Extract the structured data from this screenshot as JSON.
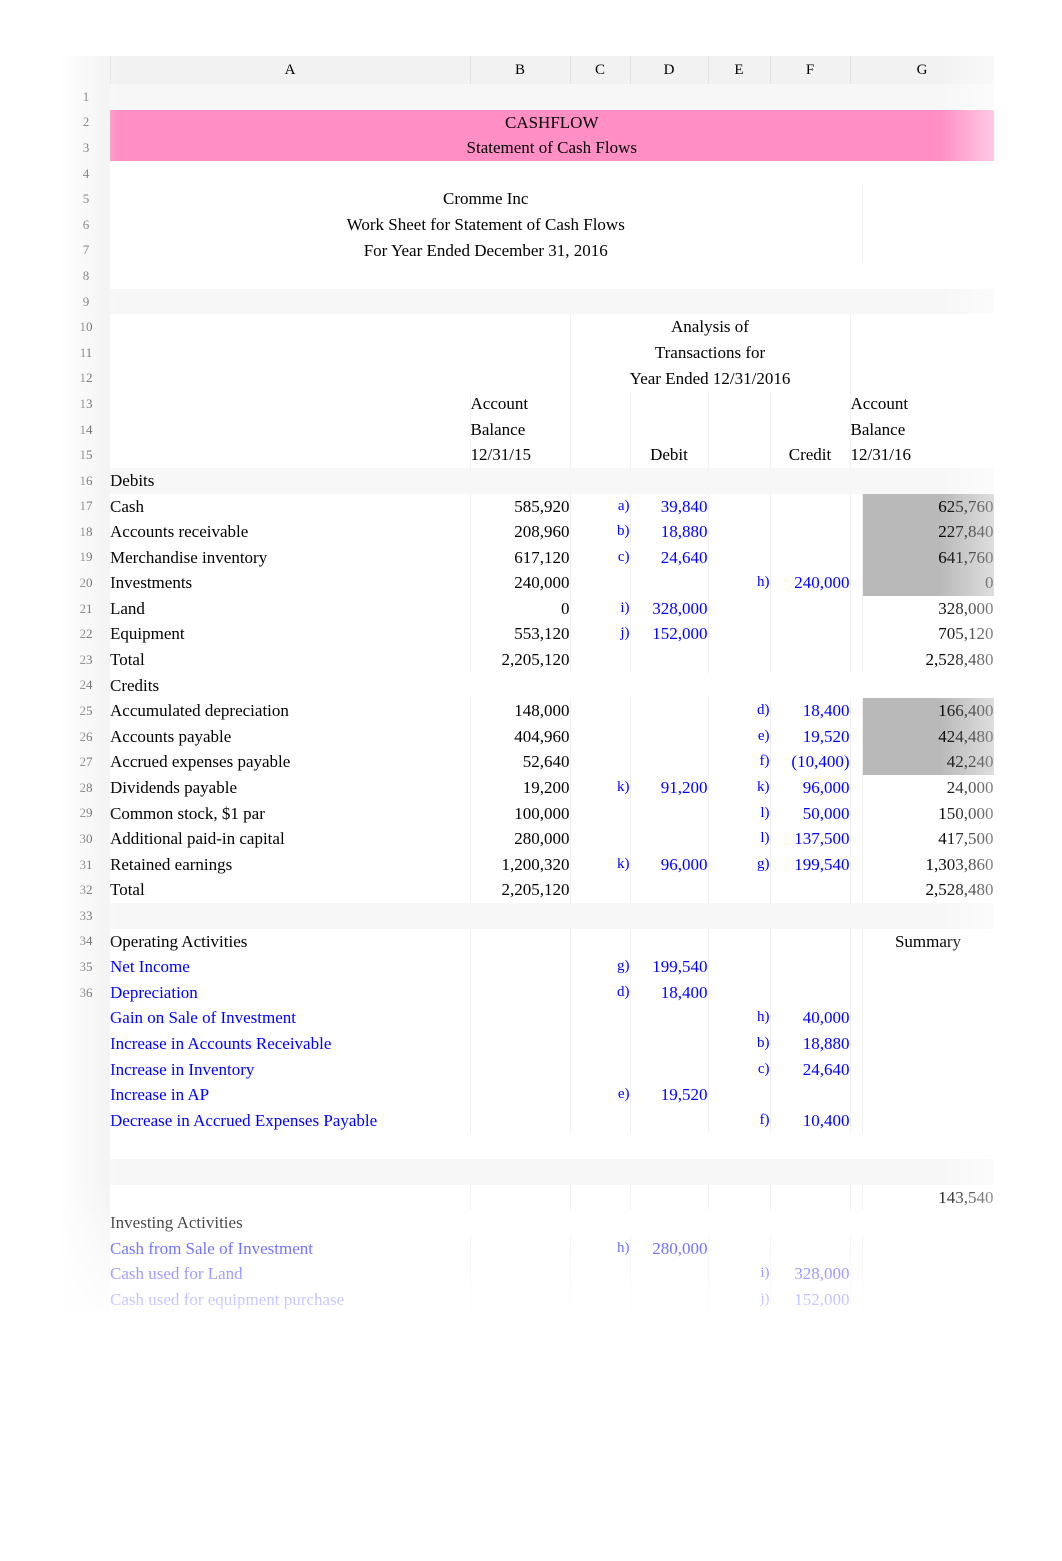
{
  "sheet": {
    "column_headers": [
      "A",
      "B",
      "C",
      "D",
      "E",
      "F",
      "G"
    ],
    "row_numbers": [
      "1",
      "2",
      "3",
      "4",
      "5",
      "6",
      "7",
      "8",
      "9",
      "10",
      "11",
      "12",
      "13",
      "14",
      "15",
      "16",
      "17",
      "18",
      "19",
      "20",
      "21",
      "22",
      "23",
      "24",
      "25",
      "26",
      "27",
      "28",
      "29",
      "30",
      "31",
      "32",
      "33",
      "34",
      "35",
      "36"
    ]
  },
  "colors": {
    "banner_pink": "#ff8fc4",
    "selection_gray": "#b9b9b9",
    "entry_blue": "#0000ff",
    "text_black": "#000000"
  },
  "banner": {
    "line1": "CASHFLOW",
    "line2": "Statement of Cash Flows"
  },
  "title_block": {
    "company": "Cromme Inc",
    "subtitle": "Work Sheet for Statement of Cash Flows",
    "period": "For Year Ended December 31, 2016"
  },
  "analysis_header": {
    "line1": "Analysis of",
    "line2": "Transactions for",
    "line3": "Year Ended 12/31/2016"
  },
  "column_labels": {
    "bal_open_1": "Account",
    "bal_open_2": "Balance",
    "bal_open_3": "12/31/15",
    "debit": "Debit",
    "credit": "Credit",
    "bal_close_1": "Account",
    "bal_close_2": "Balance",
    "bal_close_3": "12/31/16",
    "summary": "Summary"
  },
  "sections": {
    "debits_label": "Debits",
    "credits_label": "Credits",
    "operating_label": "Operating Activities",
    "investing_label": "Investing Activities"
  },
  "debit_rows": [
    {
      "row": "17",
      "name": "Cash",
      "open": "585,920",
      "dtag": "a)",
      "debit": "39,840",
      "ctag": "",
      "credit": "",
      "close": "625,760",
      "hl": true
    },
    {
      "row": "18",
      "name": "Accounts receivable",
      "open": "208,960",
      "dtag": "b)",
      "debit": "18,880",
      "ctag": "",
      "credit": "",
      "close": "227,840",
      "hl": true
    },
    {
      "row": "19",
      "name": "Merchandise inventory",
      "open": "617,120",
      "dtag": "c)",
      "debit": "24,640",
      "ctag": "",
      "credit": "",
      "close": "641,760",
      "hl": true
    },
    {
      "row": "20",
      "name": "Investments",
      "open": "240,000",
      "dtag": "",
      "debit": "",
      "ctag": "h)",
      "credit": "240,000",
      "close": "0",
      "hl": true
    },
    {
      "row": "21",
      "name": "Land",
      "open": "0",
      "dtag": "i)",
      "debit": "328,000",
      "ctag": "",
      "credit": "",
      "close": "328,000",
      "hl": false
    },
    {
      "row": "22",
      "name": "Equipment",
      "open": "553,120",
      "dtag": "j)",
      "debit": "152,000",
      "ctag": "",
      "credit": "",
      "close": "705,120",
      "hl": false
    },
    {
      "row": "23",
      "name": "Total",
      "open": "2,205,120",
      "dtag": "",
      "debit": "",
      "ctag": "",
      "credit": "",
      "close": "2,528,480",
      "hl": false
    }
  ],
  "credit_rows": [
    {
      "row": "25",
      "name": "Accumulated depreciation",
      "open": "148,000",
      "dtag": "",
      "debit": "",
      "ctag": "d)",
      "credit": "18,400",
      "close": "166,400",
      "hl": true
    },
    {
      "row": "26",
      "name": "Accounts payable",
      "open": "404,960",
      "dtag": "",
      "debit": "",
      "ctag": "e)",
      "credit": "19,520",
      "close": "424,480",
      "hl": true
    },
    {
      "row": "27",
      "name": "Accrued expenses payable",
      "open": "52,640",
      "dtag": "",
      "debit": "",
      "ctag": "f)",
      "credit": "(10,400)",
      "close": "42,240",
      "hl": true
    },
    {
      "row": "28",
      "name": "Dividends payable",
      "open": "19,200",
      "dtag": "k)",
      "debit": "91,200",
      "ctag": "k)",
      "credit": "96,000",
      "close": "24,000",
      "hl": false
    },
    {
      "row": "29",
      "name": "Common stock, $1 par",
      "open": "100,000",
      "dtag": "",
      "debit": "",
      "ctag": "l)",
      "credit": "50,000",
      "close": "150,000",
      "hl": false
    },
    {
      "row": "30",
      "name": "Additional paid-in capital",
      "open": "280,000",
      "dtag": "",
      "debit": "",
      "ctag": "l)",
      "credit": "137,500",
      "close": "417,500",
      "hl": false
    },
    {
      "row": "31",
      "name": "Retained earnings",
      "open": "1,200,320",
      "dtag": "k)",
      "debit": "96,000",
      "ctag": "g)",
      "credit": "199,540",
      "close": "1,303,860",
      "hl": false
    },
    {
      "row": "32",
      "name": "Total",
      "open": "2,205,120",
      "dtag": "",
      "debit": "",
      "ctag": "",
      "credit": "",
      "close": "2,528,480",
      "hl": false
    }
  ],
  "operating_rows": [
    {
      "row": "35",
      "name": "Net Income",
      "dtag": "g)",
      "debit": "199,540",
      "ctag": "",
      "credit": ""
    },
    {
      "row": "36",
      "name": "Depreciation",
      "dtag": "d)",
      "debit": "18,400",
      "ctag": "",
      "credit": ""
    },
    {
      "row": "",
      "name": "Gain on Sale of Investment",
      "dtag": "",
      "debit": "",
      "ctag": "h)",
      "credit": "40,000"
    },
    {
      "row": "",
      "name": "Increase in Accounts Receivable",
      "dtag": "",
      "debit": "",
      "ctag": "b)",
      "credit": "18,880"
    },
    {
      "row": "",
      "name": "Increase in Inventory",
      "dtag": "",
      "debit": "",
      "ctag": "c)",
      "credit": "24,640"
    },
    {
      "row": "",
      "name": "Increase in AP",
      "dtag": "e)",
      "debit": "19,520",
      "ctag": "",
      "credit": ""
    },
    {
      "row": "",
      "name": "Decrease in Accrued Expenses Payable",
      "dtag": "",
      "debit": "",
      "ctag": "f)",
      "credit": "10,400"
    }
  ],
  "operating_summary": "143,540",
  "investing_rows": [
    {
      "name": "Cash from Sale of Investment",
      "dtag": "h)",
      "debit": "280,000",
      "ctag": "",
      "credit": ""
    },
    {
      "name": "Cash used for Land",
      "dtag": "",
      "debit": "",
      "ctag": "i)",
      "credit": "328,000"
    },
    {
      "name": "Cash used for equipment purchase",
      "dtag": "",
      "debit": "",
      "ctag": "j)",
      "credit": "152,000"
    }
  ]
}
